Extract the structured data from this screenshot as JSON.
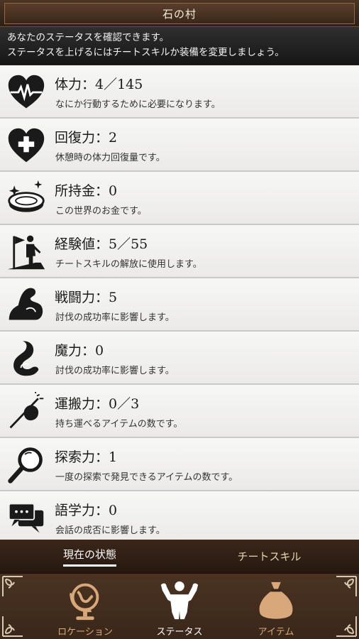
{
  "header": {
    "title": "石の村"
  },
  "info": {
    "line1": "あなたのステータスを確認できます。",
    "line2": "ステータスを上げるにはチートスキルか装備を変更しましょう。"
  },
  "stats": [
    {
      "icon": "heart-pulse-icon",
      "label": "体力：4／145",
      "desc": "なにか行動するために必要になります。"
    },
    {
      "icon": "heart-plus-icon",
      "label": "回復力：2",
      "desc": "休憩時の体力回復量です。"
    },
    {
      "icon": "coin-icon",
      "label": "所持金：0",
      "desc": "この世界のお金です。"
    },
    {
      "icon": "climber-flag-icon",
      "label": "経験値：5／55",
      "desc": "チートスキルの解放に使用します。"
    },
    {
      "icon": "muscle-arm-icon",
      "label": "戦闘力：5",
      "desc": "討伐の成功率に影響します。"
    },
    {
      "icon": "swirl-icon",
      "label": "魔力：0",
      "desc": "討伐の成功率に影響します。"
    },
    {
      "icon": "bundle-stick-icon",
      "label": "運搬力：0／3",
      "desc": "持ち運べるアイテムの数です。"
    },
    {
      "icon": "magnifier-icon",
      "label": "探索力：1",
      "desc": "一度の探索で発見できるアイテムの数です。"
    },
    {
      "icon": "speech-bubbles-icon",
      "label": "語学力：0",
      "desc": "会話の成否に影響します。"
    }
  ],
  "subtabs": {
    "current": "現在の状態",
    "cheat": "チートスキル"
  },
  "nav": {
    "location": "ロケーション",
    "status": "ステータス",
    "items": "アイテム"
  },
  "colors": {
    "nav_inactive": "#d9a87a",
    "banner": "#1e1e1e",
    "list_bg": "#f1f0ee",
    "accent_brown": "#3b271a"
  }
}
